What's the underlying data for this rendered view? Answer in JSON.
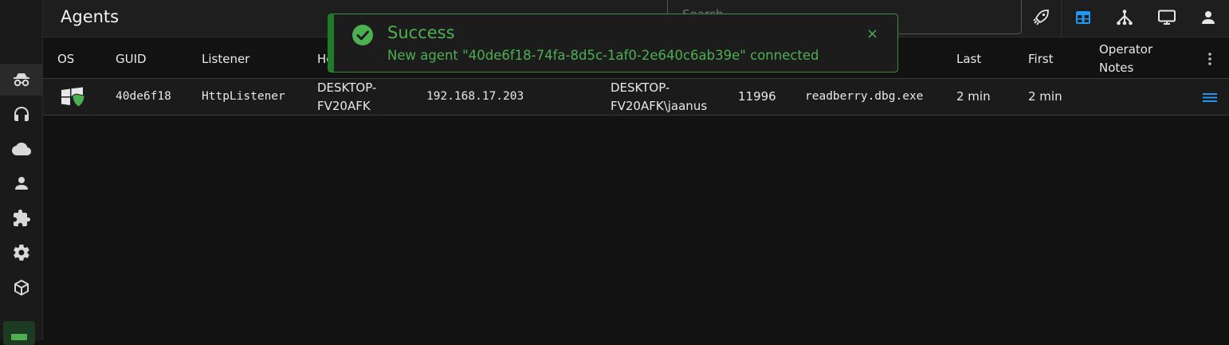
{
  "header": {
    "title": "Agents",
    "search_placeholder": "Search..."
  },
  "toolbar": {
    "icons": [
      "rocket-icon",
      "grid-view-icon",
      "graph-view-icon",
      "monitor-icon",
      "user-icon"
    ],
    "active": "grid-view-icon",
    "accent_color": "#2196f3"
  },
  "sidebar": {
    "items": [
      "agents-icon",
      "listeners-icon",
      "cloud-icon",
      "operators-icon",
      "plugins-icon",
      "settings-icon",
      "payloads-icon"
    ],
    "active": "agents-icon"
  },
  "table": {
    "columns": [
      "OS",
      "GUID",
      "Listener",
      "Ho",
      "Last",
      "First",
      "Operator\nNotes"
    ],
    "rows": [
      {
        "os_icon": "windows-shield-icon",
        "guid": "40de6f18",
        "listener": "HttpListener",
        "hostname": "DESKTOP-\nFV20AFK",
        "ip": "192.168.17.203",
        "user": "DESKTOP-\nFV20AFK\\jaanus",
        "pid": "11996",
        "process": "readberry.dbg.exe",
        "last": "2 min",
        "first": "2 min",
        "notes": ""
      }
    ]
  },
  "toast": {
    "title": "Success",
    "message": "New agent \"40de6f18-74fa-8d5c-1af0-2e640c6ab39e\" connected",
    "close": "×",
    "color": "#4caf50"
  }
}
